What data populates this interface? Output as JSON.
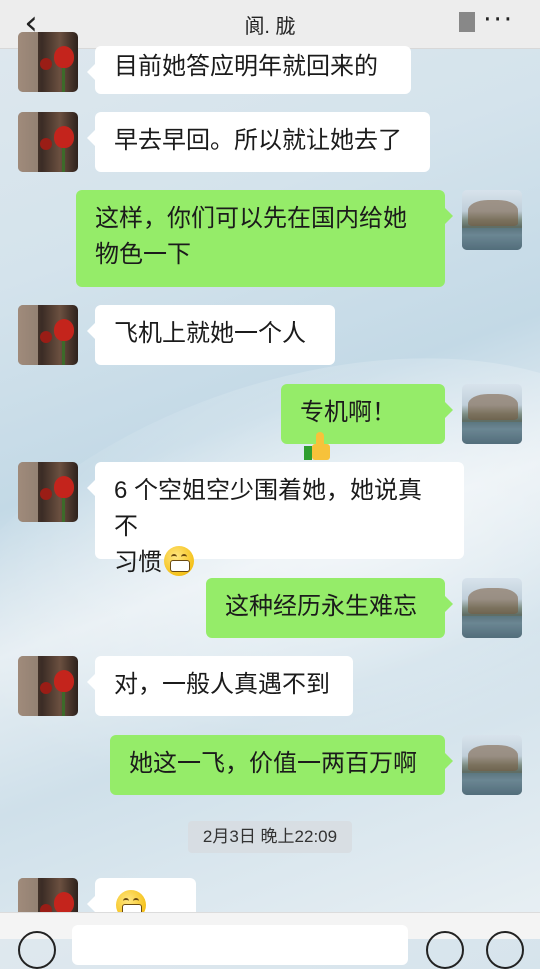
{
  "header": {
    "back_icon": "chevron-left-icon",
    "title": "阆. 胧",
    "more_icon": "more-dots-icon",
    "more_glyph": "···"
  },
  "messages": [
    {
      "side": "left",
      "text": "目前她答应明年就回来的"
    },
    {
      "side": "left",
      "text": "早去早回。所以就让她去了"
    },
    {
      "side": "right",
      "line1": "这样，你们可以先在国内给她",
      "line2": "物色一下"
    },
    {
      "side": "left",
      "text": "飞机上就她一个人"
    },
    {
      "side": "right",
      "text": "专机啊！",
      "icon": "thumbs-up-icon"
    },
    {
      "side": "left",
      "line1": "6 个空姐空少围着她，她说真不",
      "line2": "习惯",
      "icon": "grin-emoji-icon"
    },
    {
      "side": "right",
      "text": "这种经历永生难忘"
    },
    {
      "side": "left",
      "text": "对，一般人真遇不到"
    },
    {
      "side": "right",
      "text": "她这一飞，价值一两百万啊"
    },
    {
      "side": "left",
      "icons": [
        "grin-emoji-icon",
        "grin-emoji-icon"
      ]
    }
  ],
  "timestamp": "2月3日 晚上22:09",
  "colors": {
    "sent_bubble": "#95ec69",
    "received_bubble": "#ffffff",
    "header_bg": "#ededed"
  }
}
